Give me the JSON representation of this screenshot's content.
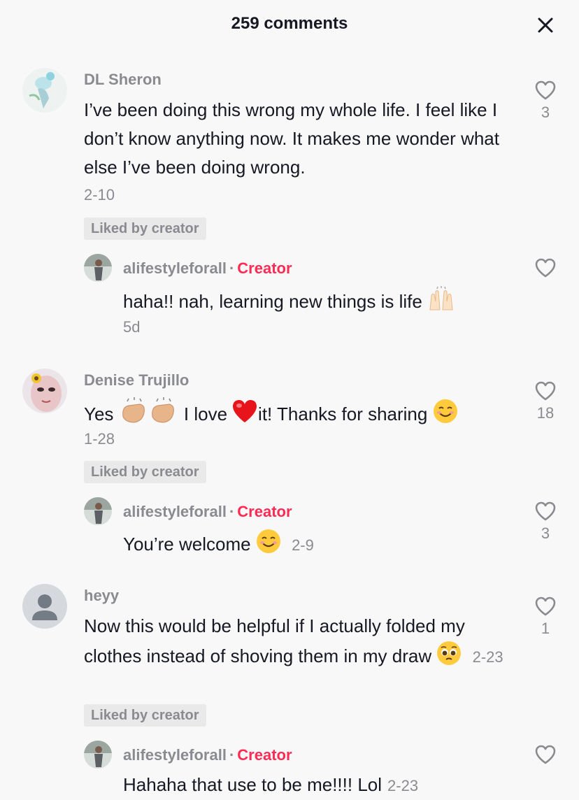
{
  "header": {
    "title": "259 comments",
    "close_icon": "close-icon"
  },
  "comments": [
    {
      "username": "DL Sheron",
      "text": "I’ve been doing this wrong my whole life. I feel like I don’t know anything now. It makes me wonder what else I’ve been doing wrong.",
      "date": "2-10",
      "liked_by_creator": "Liked by creator",
      "likes": "3",
      "reply": {
        "username": "alifestyleforall",
        "badge": "Creator",
        "text": "haha!! nah, learning new things is life",
        "emoji": "raising-hands-icon",
        "date": "5d",
        "likes": ""
      }
    },
    {
      "username": "Denise Trujillo",
      "text_parts": [
        "Yes",
        "I love",
        "it! Thanks for sharing"
      ],
      "emojis": [
        "clapping-hands-icon",
        "red-heart-icon",
        "smiling-face-icon"
      ],
      "date": "1-28",
      "liked_by_creator": "Liked by creator",
      "likes": "18",
      "reply": {
        "username": "alifestyleforall",
        "badge": "Creator",
        "text": "You’re welcome",
        "emoji": "smiling-face-icon",
        "date": "2-9",
        "likes": "3"
      }
    },
    {
      "username": "heyy",
      "text": "Now this would be helpful if I actually folded my clothes instead of shoving them in my draw",
      "emoji": "pleading-face-icon",
      "date": "2-23",
      "liked_by_creator": "Liked by creator",
      "likes": "1",
      "reply": {
        "username": "alifestyleforall",
        "badge": "Creator",
        "text": "Hahaha that use to be me!!!! Lol",
        "date": "2-23",
        "likes": ""
      }
    }
  ],
  "colors": {
    "creator_accent": "#fe2c55",
    "secondary_text": "#8a8b91",
    "primary_text": "#161823"
  }
}
